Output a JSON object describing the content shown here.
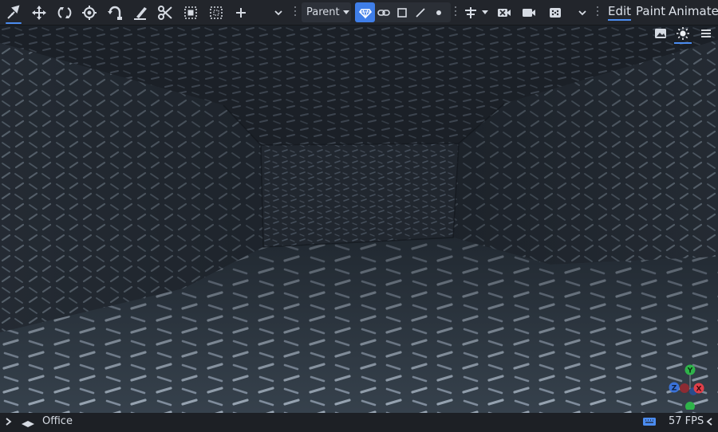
{
  "toolbar": {
    "tools": [
      {
        "name": "select-tool",
        "icon": "select-arrow-icon",
        "active": true
      },
      {
        "name": "move-tool",
        "icon": "move-arrows-icon"
      },
      {
        "name": "rotate-tool",
        "icon": "rotate-icon"
      },
      {
        "name": "scale-tool",
        "icon": "scale-target-icon"
      },
      {
        "name": "transform-tool",
        "icon": "transform-icon"
      },
      {
        "name": "paint-tool",
        "icon": "brush-icon"
      },
      {
        "name": "cut-tool",
        "icon": "scissors-icon"
      },
      {
        "name": "select-box-tool",
        "icon": "select-box-icon"
      },
      {
        "name": "select-area-tool",
        "icon": "dotted-box-icon"
      },
      {
        "name": "add-tool",
        "icon": "plus-icon"
      }
    ],
    "parent_label": "Parent",
    "accent_color": "#3f7ee8"
  },
  "modes": {
    "edit": "Edit",
    "paint": "Paint",
    "animate": "Animate",
    "active": "edit"
  },
  "statusbar": {
    "scene_name": "Office",
    "fps": "57 FPS"
  },
  "gizmo": {
    "y_label": "Y",
    "x_label": "X",
    "z_label": "Z",
    "y_color": "#2fb34a",
    "x_color": "#e0404a",
    "z_color": "#3a72d8"
  }
}
